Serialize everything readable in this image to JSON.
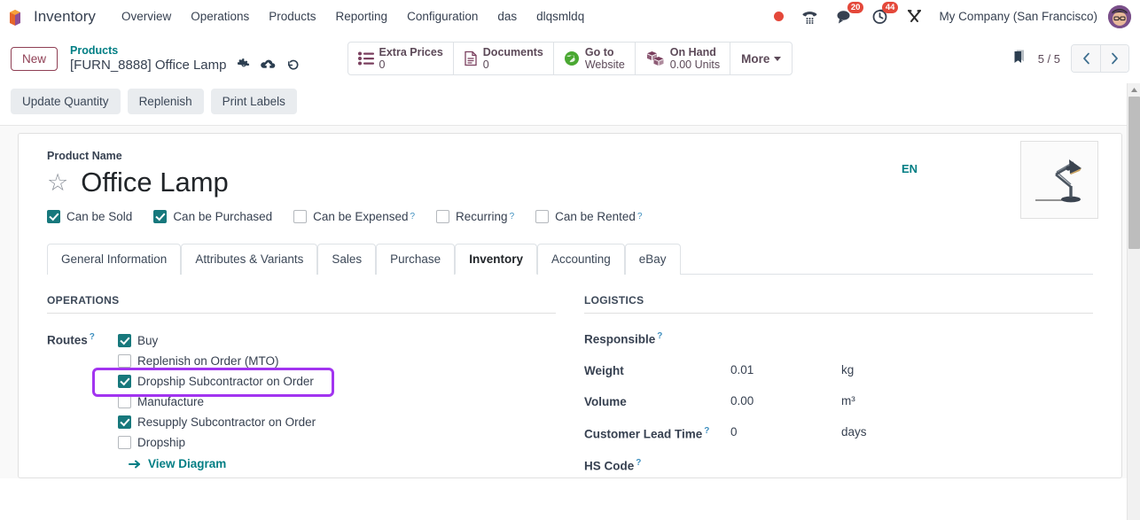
{
  "navbar": {
    "brand": "Inventory",
    "menu": [
      "Overview",
      "Operations",
      "Products",
      "Reporting",
      "Configuration",
      "das",
      "dlqsmldq"
    ],
    "icons": [
      {
        "name": "recording-indicator-icon",
        "badge": ""
      },
      {
        "name": "phone-dialpad-icon",
        "badge": ""
      },
      {
        "name": "messages-icon",
        "badge": "20"
      },
      {
        "name": "activities-clock-icon",
        "badge": "44"
      },
      {
        "name": "tools-wrench-icon",
        "badge": ""
      }
    ],
    "company": "My Company (San Francisco)",
    "accent_color": "#e4483a"
  },
  "control_panel": {
    "new_label": "New",
    "breadcrumb_parent": "Products",
    "breadcrumb_current": "[FURN_8888] Office Lamp",
    "record_icons": [
      "gear-icon",
      "cloud-upload-save-icon",
      "discard-undo-icon"
    ],
    "smart_buttons": [
      {
        "icon": "list-icon",
        "label": "Extra Prices",
        "value": "0"
      },
      {
        "icon": "document-icon",
        "label": "Documents",
        "value": "0"
      },
      {
        "icon": "globe-icon",
        "label": "Go to",
        "value": "Website"
      },
      {
        "icon": "boxes-icon",
        "label": "On Hand",
        "value": "0.00 Units"
      }
    ],
    "more_label": "More",
    "pager": "5 / 5",
    "actions": [
      "Update Quantity",
      "Replenish",
      "Print Labels"
    ]
  },
  "form": {
    "product_name_label": "Product Name",
    "product_name": "Office Lamp",
    "language_badge": "EN",
    "flags": [
      {
        "label": "Can be Sold",
        "checked": true,
        "help": false
      },
      {
        "label": "Can be Purchased",
        "checked": true,
        "help": false
      },
      {
        "label": "Can be Expensed",
        "checked": false,
        "help": true
      },
      {
        "label": "Recurring",
        "checked": false,
        "help": true
      },
      {
        "label": "Can be Rented",
        "checked": false,
        "help": true
      }
    ],
    "tabs": [
      {
        "label": "General Information",
        "active": false
      },
      {
        "label": "Attributes & Variants",
        "active": false
      },
      {
        "label": "Sales",
        "active": false
      },
      {
        "label": "Purchase",
        "active": false
      },
      {
        "label": "Inventory",
        "active": true
      },
      {
        "label": "Accounting",
        "active": false
      },
      {
        "label": "eBay",
        "active": false
      }
    ]
  },
  "operations": {
    "section_title": "Operations",
    "routes_label": "Routes",
    "routes": [
      {
        "label": "Buy",
        "checked": true
      },
      {
        "label": "Replenish on Order (MTO)",
        "checked": false
      },
      {
        "label": "Dropship Subcontractor on Order",
        "checked": true,
        "highlighted": true
      },
      {
        "label": "Manufacture",
        "checked": false
      },
      {
        "label": "Resupply Subcontractor on Order",
        "checked": true
      },
      {
        "label": "Dropship",
        "checked": false
      }
    ],
    "view_diagram_label": "View Diagram",
    "highlight_color": "#a234f0"
  },
  "logistics": {
    "section_title": "Logistics",
    "fields": [
      {
        "label": "Responsible",
        "value": "",
        "unit": "",
        "help": true
      },
      {
        "label": "Weight",
        "value": "0.01",
        "unit": "kg",
        "help": false
      },
      {
        "label": "Volume",
        "value": "0.00",
        "unit": "m³",
        "help": false
      },
      {
        "label": "Customer Lead Time",
        "value": "0",
        "unit": "days",
        "help": true
      },
      {
        "label": "HS Code",
        "value": "",
        "unit": "",
        "help": true
      }
    ]
  }
}
